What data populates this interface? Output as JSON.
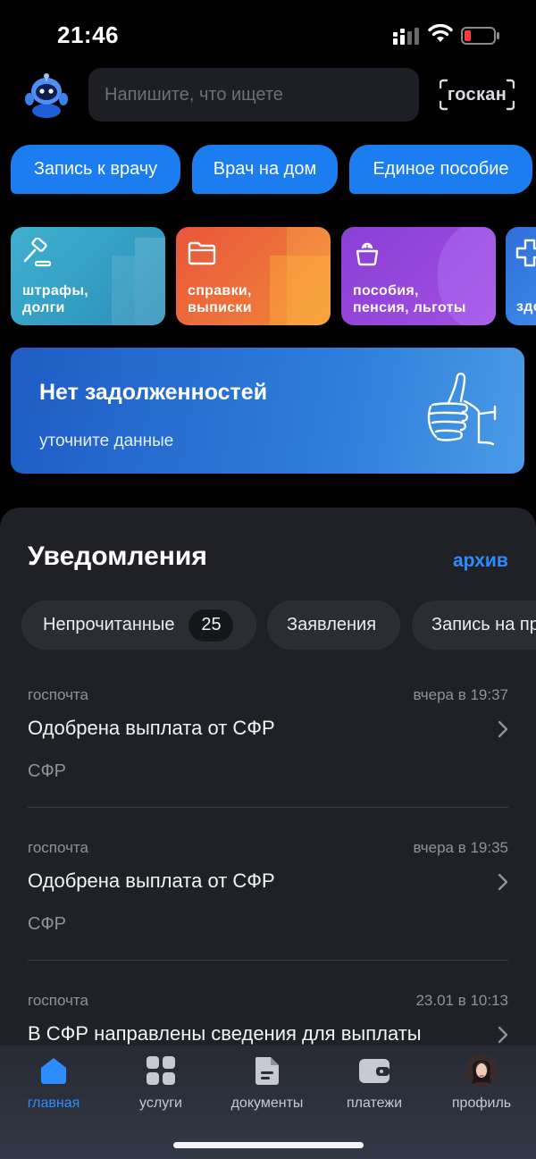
{
  "status": {
    "time": "21:46"
  },
  "header": {
    "search_placeholder": "Напишите, что ищете",
    "goscan_label": "госкан"
  },
  "chips": [
    "Запись к врачу",
    "Врач на дом",
    "Единое пособие"
  ],
  "tiles": [
    {
      "label": "штрафы,\nдолги",
      "icon": "gavel-icon"
    },
    {
      "label": "справки,\nвыписки",
      "icon": "folder-icon"
    },
    {
      "label": "пособия,\nпенсия, льготы",
      "icon": "wallet-icon"
    },
    {
      "label": "здоровье",
      "icon": "plus-icon"
    }
  ],
  "banner": {
    "title": "Нет задолженностей",
    "subtitle": "уточните данные"
  },
  "notifications": {
    "title": "Уведомления",
    "archive": "архив",
    "filters": [
      {
        "label": "Непрочитанные",
        "count": "25"
      },
      {
        "label": "Заявления"
      },
      {
        "label": "Запись на прием"
      }
    ],
    "items": [
      {
        "source": "госпочта",
        "time": "вчера в 19:37",
        "title": "Одобрена выплата от СФР",
        "org": "СФР"
      },
      {
        "source": "госпочта",
        "time": "вчера в 19:35",
        "title": "Одобрена выплата от СФР",
        "org": "СФР"
      },
      {
        "source": "госпочта",
        "time": "23.01 в 10:13",
        "title": "В СФР направлены сведения для выплаты",
        "org": ""
      }
    ]
  },
  "tabbar": [
    {
      "label": "главная",
      "icon": "home-icon"
    },
    {
      "label": "услуги",
      "icon": "services-grid-icon"
    },
    {
      "label": "документы",
      "icon": "document-icon"
    },
    {
      "label": "платежи",
      "icon": "wallet-icon"
    },
    {
      "label": "профиль",
      "icon": "avatar"
    }
  ],
  "colors": {
    "accent": "#2d8cff",
    "chip": "#1b7df0",
    "sheet": "#202127"
  }
}
